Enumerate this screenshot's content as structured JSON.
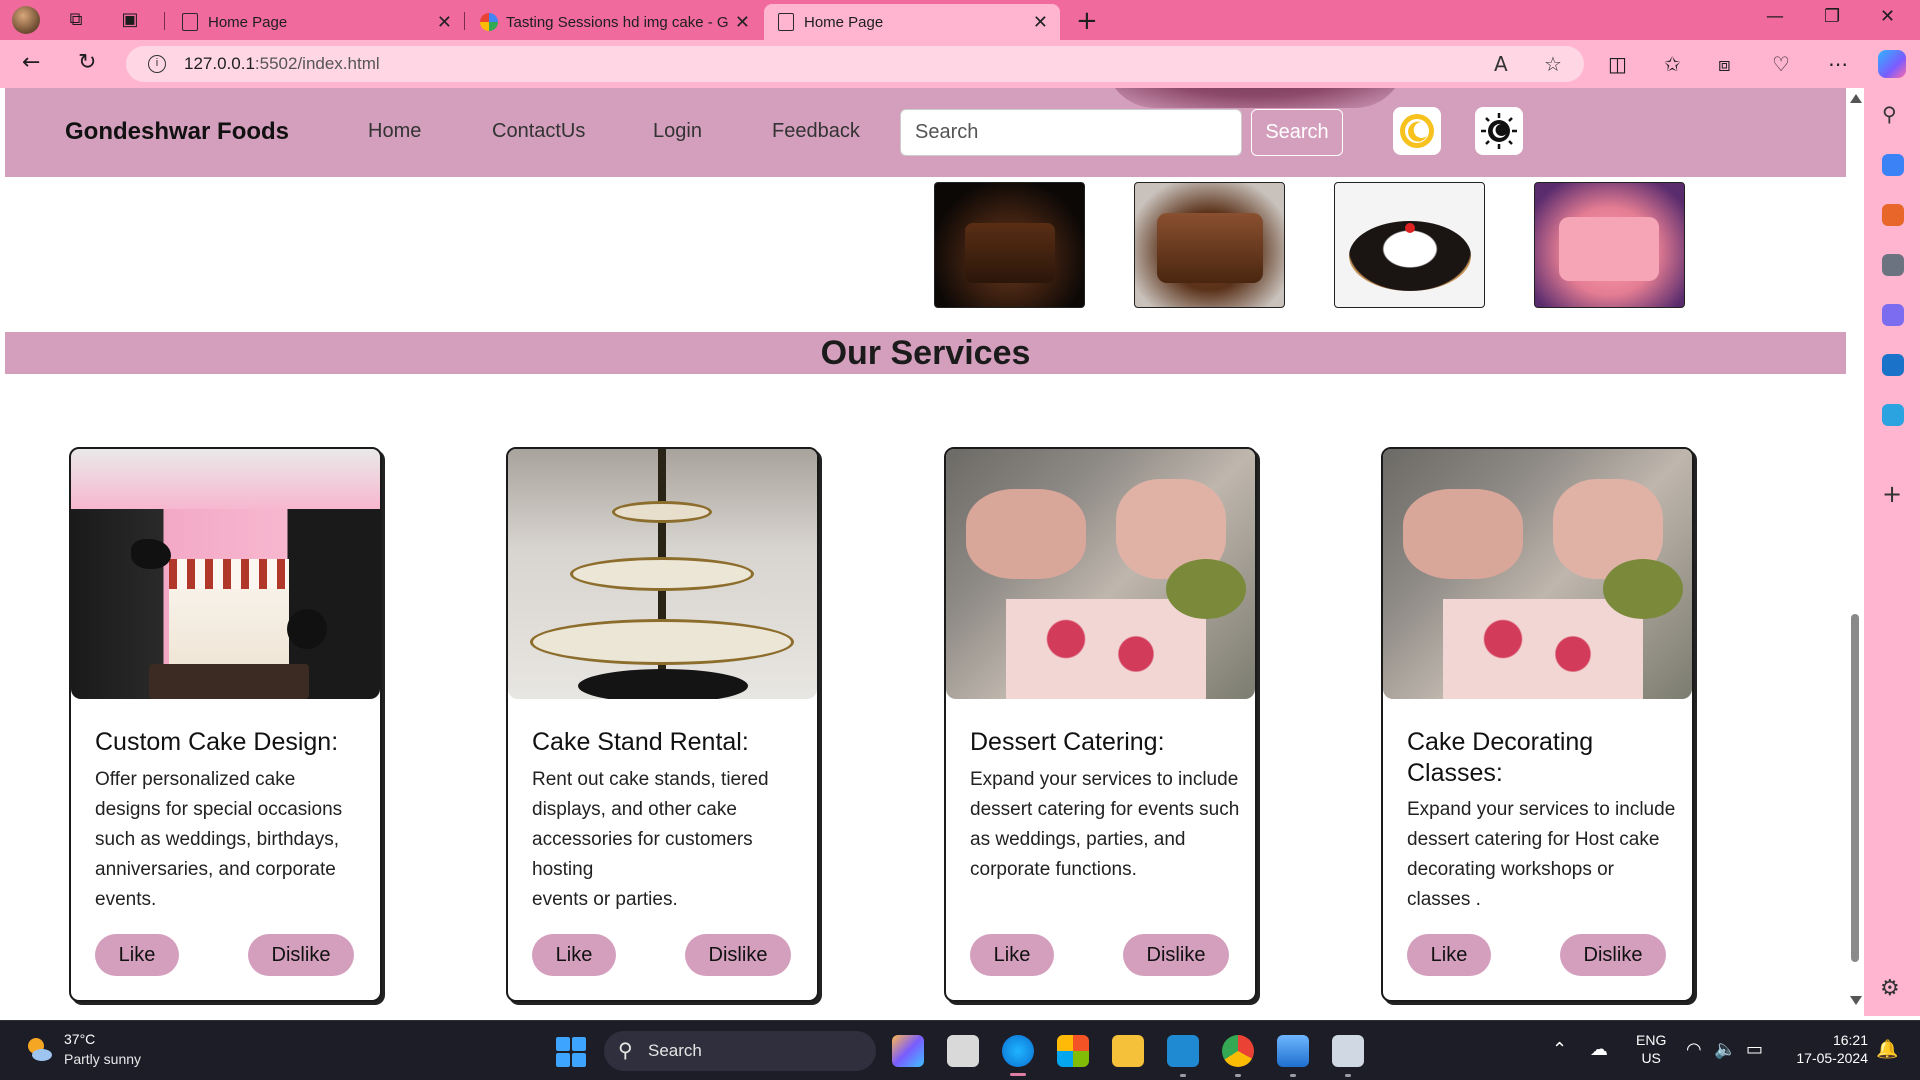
{
  "browser": {
    "tabs": [
      {
        "title": "Home Page",
        "active": false,
        "favicon": "page-icon"
      },
      {
        "title": "Tasting Sessions hd img cake - G",
        "active": false,
        "favicon": "google-icon"
      },
      {
        "title": "Home Page",
        "active": true,
        "favicon": "page-icon"
      }
    ],
    "url_host": "127.0.0.1",
    "url_rest": ":5502/index.html"
  },
  "site": {
    "brand": "Gondeshwar Foods",
    "nav": [
      "Home",
      "ContactUs",
      "Login",
      "Feedback"
    ],
    "search_placeholder": "Search",
    "search_button": "Search",
    "theme_icons": [
      "light-mode-icon",
      "dark-mode-icon"
    ],
    "thumbnails": [
      "chocolate-drip-cake",
      "chocolate-frosted-cake",
      "black-forest-cake",
      "pink-rose-cake"
    ]
  },
  "services": {
    "heading": "Our Services",
    "cards": [
      {
        "title": "Custom Cake Design:",
        "description": "Offer personalized cake designs for special occasions such as weddings, birthdays, anniversaries, and corporate events.",
        "like": "Like",
        "dislike": "Dislike"
      },
      {
        "title": "Cake Stand Rental:",
        "description": "Rent out cake stands, tiered displays, and other cake accessories for customers hosting",
        "description_extra": "events or parties.",
        "like": "Like",
        "dislike": "Dislike"
      },
      {
        "title": "Dessert Catering:",
        "description": "Expand your services to include dessert catering for events such as weddings, parties, and corporate functions.",
        "like": "Like",
        "dislike": "Dislike"
      },
      {
        "title": "Cake Decorating Classes:",
        "description": "Expand your services to include dessert catering for Host cake decorating workshops or classes .",
        "like": "Like",
        "dislike": "Dislike"
      }
    ]
  },
  "taskbar": {
    "temperature": "37°C",
    "weather": "Partly sunny",
    "search": "Search",
    "lang_1": "ENG",
    "lang_2": "US",
    "time": "16:21",
    "date": "17-05-2024"
  },
  "colors": {
    "accent_pink": "#f06a9d",
    "nav_mauve": "#d49fbd"
  }
}
